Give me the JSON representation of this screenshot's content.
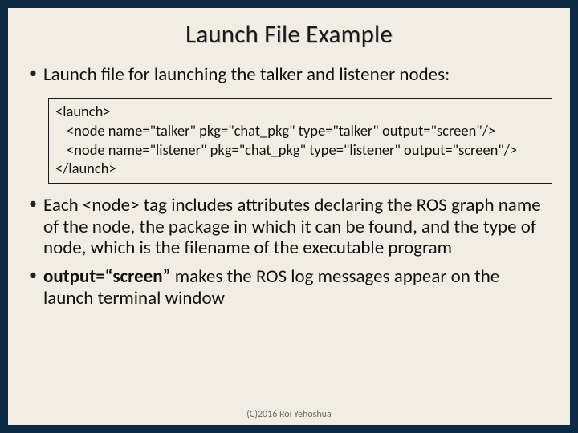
{
  "title": "Launch File Example",
  "bullet1": "Launch file for launching the talker and listener nodes:",
  "code": {
    "l1": "<launch>",
    "l2": "<node name=\"talker\" pkg=\"chat_pkg\" type=\"talker\" output=\"screen\"/>",
    "l3": "<node name=\"listener\" pkg=\"chat_pkg\" type=\"listener\" output=\"screen\"/>",
    "l4": "</launch>"
  },
  "bullet2_a": "Each <node> tag includes attributes declaring the ROS graph name of the node, the package in which it can be found, and the type of node, which is the filename of the executable program",
  "bullet3_bold": "output=“screen”",
  "bullet3_rest": " makes the ROS log messages appear on the launch terminal window",
  "footer": "(C)2016 Roi Yehoshua"
}
